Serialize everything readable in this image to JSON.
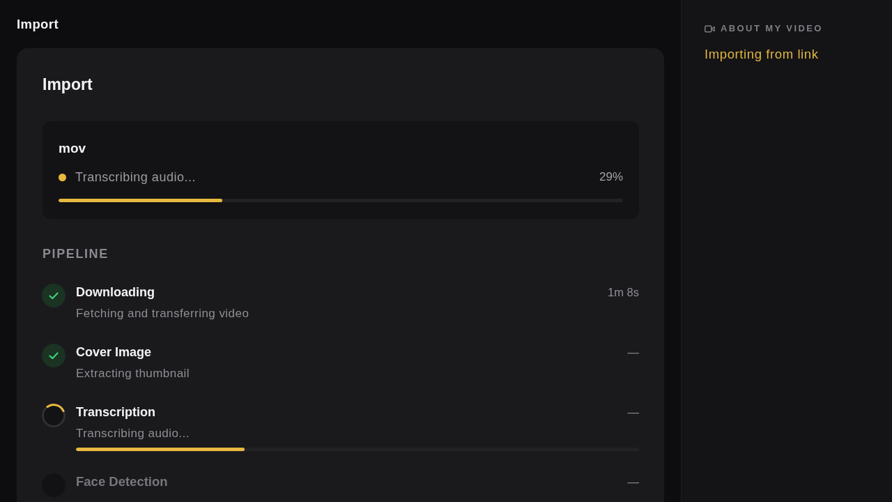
{
  "header": {
    "title": "Import"
  },
  "card": {
    "title": "Import",
    "job": {
      "name": "mov",
      "status": "Transcribing audio...",
      "percent": "29%",
      "progress": {
        "level": 0.29
      }
    },
    "pipeline": {
      "heading": "PIPELINE",
      "steps": [
        {
          "kind": "done",
          "title": "Downloading",
          "subtitle": "Fetching and transferring video",
          "time": "1m 8s"
        },
        {
          "kind": "done",
          "title": "Cover Image",
          "subtitle": "Extracting thumbnail",
          "time": "—"
        },
        {
          "kind": "active",
          "title": "Transcription",
          "subtitle": "Transcribing audio...",
          "time": "—",
          "level": 0.3
        },
        {
          "kind": "pending",
          "title": "Face Detection",
          "time": "—"
        }
      ]
    }
  },
  "sidebar": {
    "section_title": "ABOUT MY VIDEO",
    "status": "Importing from link"
  }
}
